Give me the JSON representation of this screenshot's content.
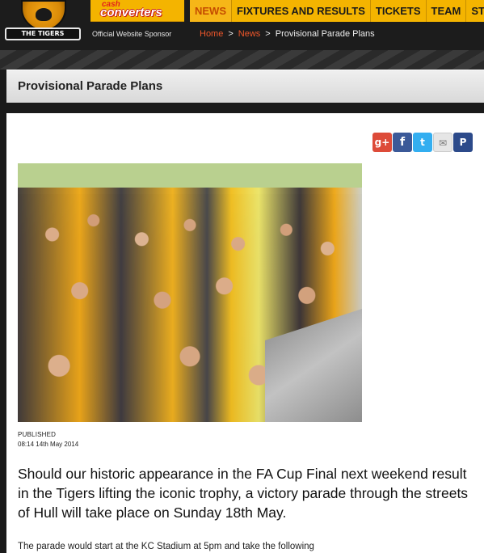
{
  "header": {
    "crest_label": "THE TIGERS",
    "sponsor_logo_top": "cash",
    "sponsor_logo_main": "converters",
    "sponsor_text": "Official Website Sponsor"
  },
  "nav": {
    "items": [
      "NEWS",
      "FIXTURES AND RESULTS",
      "TICKETS",
      "TEAM",
      "STA"
    ]
  },
  "breadcrumb": {
    "home": "Home",
    "sep1": ">",
    "news": "News",
    "sep2": ">",
    "current": "Provisional Parade Plans"
  },
  "page": {
    "title": "Provisional Parade Plans"
  },
  "share": {
    "icons": [
      "google-plus-icon",
      "facebook-icon",
      "twitter-icon",
      "email-icon",
      "pinterest-icon"
    ],
    "glyphs": [
      "g+",
      "f",
      "t",
      "✉",
      "P"
    ]
  },
  "article": {
    "published_label": "PUBLISHED",
    "published_date": "08:14 14th May 2014",
    "intro": "Should our historic appearance in the FA Cup Final next weekend result in the Tigers lifting the iconic trophy, a victory parade through the streets of Hull will take place on Sunday 18th May.",
    "body": "The parade would start at the KC Stadium at 5pm and take the following"
  },
  "colors": {
    "accent": "#f4b400",
    "nav_active": "#c44b00",
    "link": "#f0572a"
  }
}
